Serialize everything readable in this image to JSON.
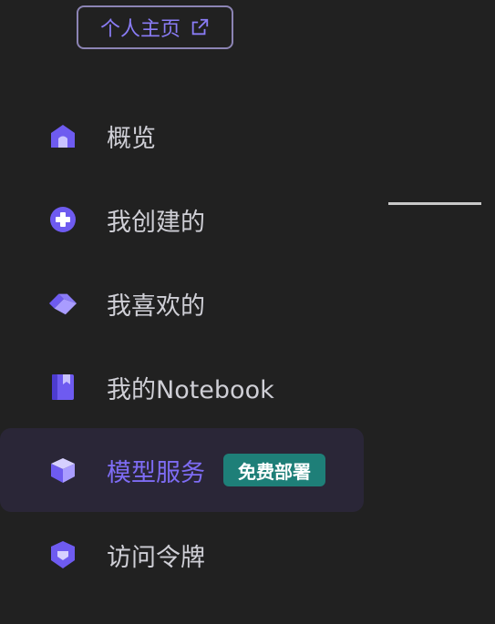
{
  "profile_button": {
    "label": "个人主页",
    "icon": "external-link-icon"
  },
  "nav": {
    "items": [
      {
        "label": "概览",
        "icon": "home-icon"
      },
      {
        "label": "我创建的",
        "icon": "plus-circle-icon"
      },
      {
        "label": "我喜欢的",
        "icon": "diamond-icon"
      },
      {
        "label": "我的Notebook",
        "icon": "notebook-icon"
      },
      {
        "label": "模型服务",
        "icon": "cube-icon",
        "badge": "免费部署",
        "active": true
      },
      {
        "label": "访问令牌",
        "icon": "shield-icon"
      }
    ]
  },
  "colors": {
    "background": "#212121",
    "accent": "#7e6cf4",
    "active_bg": "#2a2637",
    "badge_bg": "#1e7f78",
    "text": "#cfcfd6"
  }
}
